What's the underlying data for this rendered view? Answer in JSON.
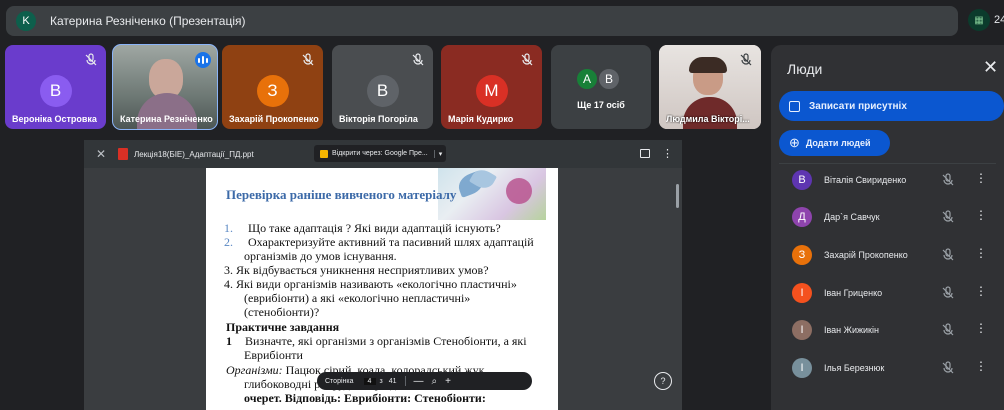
{
  "header": {
    "presenter_initial": "K",
    "presenter_title": "Катерина Резніченко (Презентація)",
    "participants_count": "24"
  },
  "tiles": [
    {
      "initial": "В",
      "name": "Вероніка Островка",
      "color": "#6a3ccc",
      "muted": true
    },
    {
      "initial": "",
      "name": "Катерина Резніченко",
      "color": "#8a8d90",
      "video": true,
      "speaking": true
    },
    {
      "initial": "З",
      "name": "Захарій Прокопенко",
      "color": "#e8710a",
      "muted": true
    },
    {
      "initial": "В",
      "name": "Вікторія Погоріла",
      "color": "#5f6368",
      "muted": true
    },
    {
      "initial": "М",
      "name": "Марія Кудирко",
      "color": "#d93025",
      "muted": true
    },
    {
      "more_label": "Ще 17 осіб",
      "more_initials": [
        "А",
        "В"
      ]
    },
    {
      "initial": "",
      "name": "Людмила Вікторі...",
      "color": "#b7a3a0",
      "video": true,
      "muted": true
    }
  ],
  "viewer": {
    "file_name": "Лекція18(БІЕ)_Адаптації_ПД.ppt",
    "open_with": "Відкрити через: Google Пре...",
    "page_label": "Сторінка",
    "page_current": "4",
    "page_of": "з",
    "page_total": "41",
    "zoom_out": "—",
    "zoom_in": "+",
    "help": "?"
  },
  "slide": {
    "title": "Перевірка раніше вивченого матеріалу",
    "q1_num": "1.",
    "q1": "Що таке адаптація ? Які види адаптацій існують?",
    "q2_num": "2.",
    "q2_a": "Охарактеризуйте активний та пасивний шлях адаптацій",
    "q2_b": "організмів до умов існування.",
    "q3": "3. Як відбувається уникнення несприятливих умов?",
    "q4_a": "4.  Які види організмів називають «екологічно пластичні»",
    "q4_b": "(еврибіонти)       а       які       «екологічно       непластичні»",
    "q4_c": "(стенобіонти)?",
    "practice_title": "Практичне завдання",
    "task_num": "1",
    "task_a": "Визначте, які організми з  організмів Стенобіонти, а які",
    "task_b": "Еврибіонти",
    "org_label": "Організми:",
    "org_a": " Пацюк      сірий,      коала,      колорадський   жук,",
    "org_b": "глибоководні р                                          и рудий, орхідея,",
    "org_c": "очерет.          Відповідь: Еврибіонти:    Стенобіонти:"
  },
  "people": {
    "title": "Люди",
    "record_attendance": "Записати присутніх",
    "add_people": "Додати людей",
    "list": [
      {
        "initial": "В",
        "name": "Віталія Свириденко",
        "color": "#5e35b1"
      },
      {
        "initial": "Д",
        "name": "Дар`я Савчук",
        "color": "#8e44ad"
      },
      {
        "initial": "З",
        "name": "Захарій Прокопенко",
        "color": "#e8710a"
      },
      {
        "initial": "І",
        "name": "Іван Гриценко",
        "color": "#f4511e"
      },
      {
        "initial": "І",
        "name": "Іван Жижикін",
        "color": "#8d6e63"
      },
      {
        "initial": "І",
        "name": "Ілья Березнюк",
        "color": "#78909c"
      }
    ]
  }
}
